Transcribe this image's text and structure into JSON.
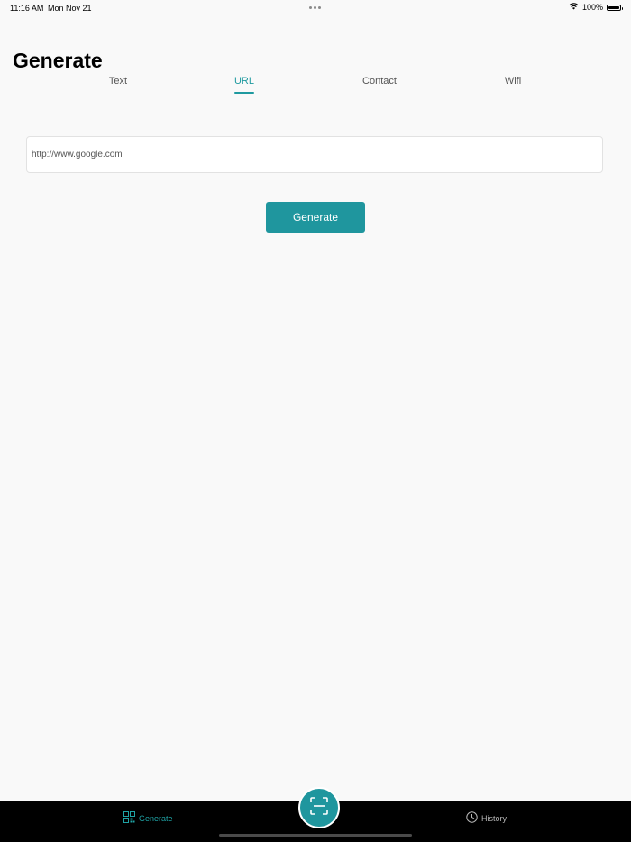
{
  "status_bar": {
    "time": "11:16 AM",
    "date": "Mon Nov 21",
    "battery": "100%",
    "icons": [
      "wifi-icon",
      "battery-icon"
    ]
  },
  "page": {
    "title": "Generate"
  },
  "tabs": [
    {
      "label": "Text",
      "active": false
    },
    {
      "label": "URL",
      "active": true
    },
    {
      "label": "Contact",
      "active": false
    },
    {
      "label": "Wifi",
      "active": false
    }
  ],
  "url_form": {
    "placeholder": "http://www.google.com",
    "value": "",
    "button_label": "Generate"
  },
  "bottom_nav": {
    "generate_label": "Generate",
    "history_label": "History",
    "icons": [
      "qr-grid-icon",
      "scan-icon",
      "clock-icon"
    ]
  },
  "colors": {
    "accent": "#1f969e",
    "background": "#f9f9f9",
    "nav_background": "#000000"
  }
}
